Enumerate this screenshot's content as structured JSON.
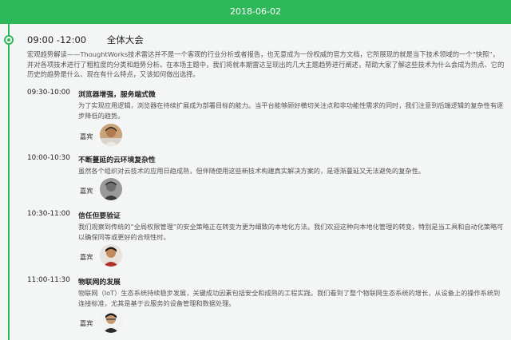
{
  "date": "2018-06-02",
  "session": {
    "time": "09:00 -12:00",
    "title": "全体大会",
    "description": "宏观趋势解读——ThoughtWorks技术雷达并不是一个客观的行业分析或者报告，也无意成为一份权威的官方文档，它所展现的就是当下技术领域的一个“快照”，并对各项技术进行了粗粒度的分类和趋势分析。在本场主题中，我们将就本期雷达呈现出的几大主题趋势进行阐述，帮助大家了解这些技术为什么会成为热点、它的历史的趋势是什么、现在有什么特点，又该如何做出选择。"
  },
  "talks": [
    {
      "time": "09:30-10:00",
      "title": "浏览器增强，服务端式微",
      "description": "为了实现应用逻辑，浏览器在持续扩展成为部署目标的能力。当平台能够顾好横切关注点和非功能性需求的同时，我们注意到后端逻辑的复杂性有逐步降低的趋势。",
      "guest_label": "嘉宾"
    },
    {
      "time": "10:00-10:30",
      "title": "不断蔓延的云环境复杂性",
      "description": "虽然各个组织对云技术的应用日趋成熟，但伴随使用这些新技术构建真实解决方案的，是逐渐蔓延又无法避免的复杂性。",
      "guest_label": "嘉宾"
    },
    {
      "time": "10:30-11:00",
      "title": "信任但要验证",
      "description": "我们观察到传统的“全局权限管理”的安全策略正在转变为更为细致的本地化方法。我们欢迎这种向本地化管理的转变，特别是当工具和自动化策略可以确保同等或更好的合规性时。",
      "guest_label": "嘉宾"
    },
    {
      "time": "11:00-11:30",
      "title": "物联网的发展",
      "description": "物联网（IoT）生态系统持续稳步发展，关键成功因素包括安全和成熟的工程实践。我们看到了整个物联网生态系统的增长，从设备上的操作系统到连接标准，尤其是基于云服务的设备管理和数据处理。",
      "guest_label": "嘉宾"
    }
  ],
  "colors": {
    "accent": "#2db85a"
  }
}
